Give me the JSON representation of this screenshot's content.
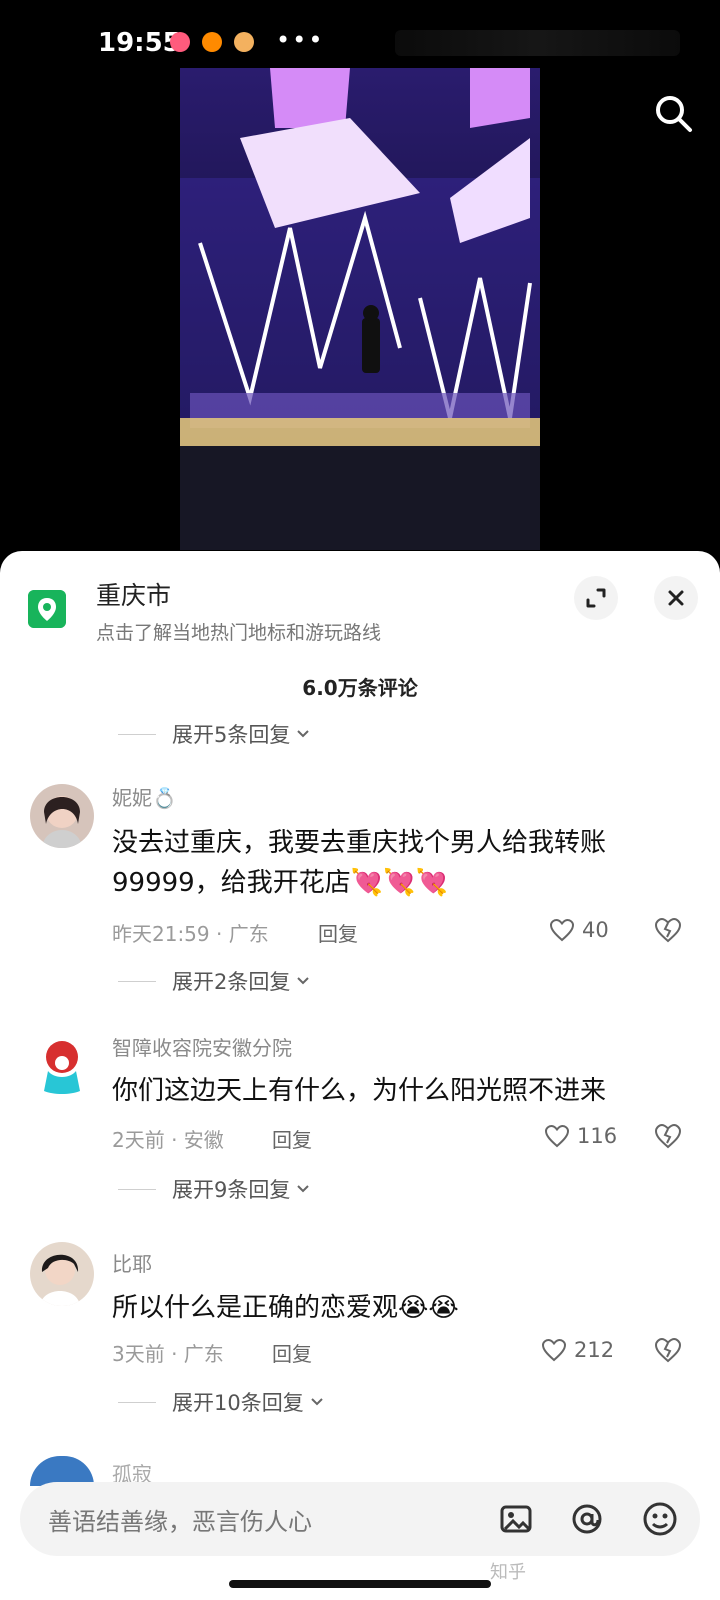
{
  "status_bar": {
    "time": "19:55",
    "dots": "•••"
  },
  "location": {
    "title": "重庆市",
    "subtitle": "点击了解当地热门地标和游玩路线"
  },
  "comment_count": "6.0万条评论",
  "expands": [
    "展开5条回复",
    "展开2条回复",
    "展开9条回复",
    "展开10条回复"
  ],
  "comments": [
    {
      "name": "妮妮💍",
      "text": "没去过重庆，我要去重庆找个男人给我转账99999，给我开花店💘💘💘",
      "meta": "昨天21:59 · 广东",
      "reply": "回复",
      "likes": "40"
    },
    {
      "name": "智障收容院安徽分院",
      "text": "你们这边天上有什么，为什么阳光照不进来",
      "meta": "2天前 · 安徽",
      "reply": "回复",
      "likes": "116"
    },
    {
      "name": "比耶",
      "text": "所以什么是正确的恋爱观😭😭",
      "meta": "3天前 · 广东",
      "reply": "回复",
      "likes": "212"
    }
  ],
  "partial_name": "孤寂",
  "input": {
    "placeholder": "善语结善缘，恶言伤人心"
  },
  "watermark": "知乎",
  "colors": {
    "location_green": "#18b45b",
    "sheet_bg": "#ffffff"
  }
}
